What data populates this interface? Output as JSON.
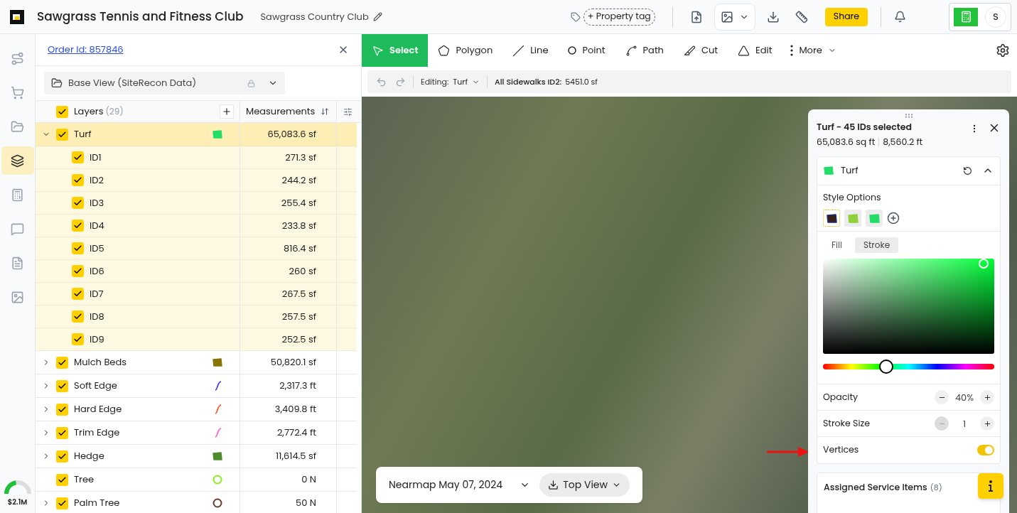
{
  "header": {
    "title": "Sawgrass Tennis and Fitness Club",
    "subtitle": "Sawgrass Country Club",
    "tag_button": "+ Property tag",
    "share": "Share",
    "avatar": "S"
  },
  "rail": {
    "items": [
      {
        "kind": "route",
        "selected": false
      },
      {
        "kind": "cart",
        "selected": false
      },
      {
        "kind": "folder",
        "selected": false
      },
      {
        "kind": "layers",
        "selected": true
      },
      {
        "kind": "calculator",
        "selected": false
      },
      {
        "kind": "chat",
        "selected": false
      },
      {
        "kind": "document",
        "selected": false
      },
      {
        "kind": "image",
        "selected": false
      }
    ],
    "budget": {
      "label": "$2.1M",
      "level": 0.45
    }
  },
  "layers_panel": {
    "order_link": "Order Id: 857846",
    "base_view": "Base View (SiteRecon Data)",
    "header": {
      "label": "Layers",
      "count": "(29)",
      "checked": true,
      "measurements": "Measurements"
    },
    "layers": [
      {
        "name": "Turf",
        "value": "65,083.6 sf",
        "checked": true,
        "expanded": true,
        "selected": true,
        "kind": "area",
        "color": "#22dd66",
        "children": [
          {
            "name": "ID1",
            "value": "271.3 sf",
            "checked": true
          },
          {
            "name": "ID2",
            "value": "244.2 sf",
            "checked": true
          },
          {
            "name": "ID3",
            "value": "255.4 sf",
            "checked": true
          },
          {
            "name": "ID4",
            "value": "233.8 sf",
            "checked": true
          },
          {
            "name": "ID5",
            "value": "816.4 sf",
            "checked": true
          },
          {
            "name": "ID6",
            "value": "260 sf",
            "checked": true
          },
          {
            "name": "ID7",
            "value": "267.5 sf",
            "checked": true
          },
          {
            "name": "ID8",
            "value": "257.5 sf",
            "checked": true
          },
          {
            "name": "ID9",
            "value": "252.5 sf",
            "checked": true
          }
        ]
      },
      {
        "name": "Mulch Beds",
        "value": "50,820.1 sf",
        "checked": true,
        "expanded": false,
        "selected": false,
        "kind": "area",
        "color": "#8a7400"
      },
      {
        "name": "Soft Edge",
        "value": "2,317.3 ft",
        "checked": true,
        "expanded": false,
        "selected": false,
        "kind": "line",
        "color": "#3a2df0"
      },
      {
        "name": "Hard Edge",
        "value": "3,409.8 ft",
        "checked": true,
        "expanded": false,
        "selected": false,
        "kind": "line",
        "color": "#ff4a1a"
      },
      {
        "name": "Trim Edge",
        "value": "2,772.4 ft",
        "checked": true,
        "expanded": false,
        "selected": false,
        "kind": "line",
        "color": "#ff55cc"
      },
      {
        "name": "Hedge",
        "value": "11,614.5 sf",
        "checked": true,
        "expanded": false,
        "selected": false,
        "kind": "area",
        "color": "#4c8a2e"
      },
      {
        "name": "Tree",
        "value": "0 N",
        "checked": true,
        "selected": false,
        "kind": "point",
        "color": "#88ee22"
      },
      {
        "name": "Palm Tree",
        "value": "50 N",
        "checked": true,
        "expanded": false,
        "selected": false,
        "kind": "point",
        "color": "#6b3a2a"
      }
    ]
  },
  "toolbar": {
    "tools": [
      {
        "kind": "select",
        "label": "Select",
        "selected": true
      },
      {
        "kind": "polygon",
        "label": "Polygon",
        "selected": false
      },
      {
        "kind": "line",
        "label": "Line",
        "selected": false
      },
      {
        "kind": "point",
        "label": "Point",
        "selected": false
      },
      {
        "kind": "path",
        "label": "Path",
        "selected": false
      },
      {
        "kind": "cut",
        "label": "Cut",
        "selected": false
      },
      {
        "kind": "edit",
        "label": "Edit",
        "selected": false
      }
    ],
    "more": "More"
  },
  "edit_bar": {
    "editing_label": "Editing:",
    "editing_value": "Turf",
    "measure_label": "All Sidewalks ID2:",
    "measure_value": "5451.0 sf"
  },
  "map": {
    "imagery": "Nearmap May 07, 2024",
    "view": "Top View"
  },
  "style_panel": {
    "title": "Turf - 45 IDs selected",
    "area": "65,083.6 sq ft",
    "length": "8,560.2 ft",
    "layer": "Turf",
    "expanded": true,
    "style_options": "Style Options",
    "styles": [
      {
        "color": "#3a1e14",
        "selected": true
      },
      {
        "color": "#8fd13a",
        "selected": false
      },
      {
        "color": "#22dd66",
        "selected": false
      }
    ],
    "tabs": [
      {
        "label": "Fill",
        "selected": false
      },
      {
        "label": "Stroke",
        "selected": true
      }
    ],
    "hue": {
      "level": 0.37
    },
    "opacity": {
      "label": "Opacity",
      "value": "40%"
    },
    "stroke_size": {
      "label": "Stroke Size",
      "value": "1",
      "minus_disabled": true
    },
    "vertices": {
      "label": "Vertices",
      "on": true
    },
    "assigned": {
      "label": "Assigned Service Items",
      "count": "(8)"
    }
  }
}
